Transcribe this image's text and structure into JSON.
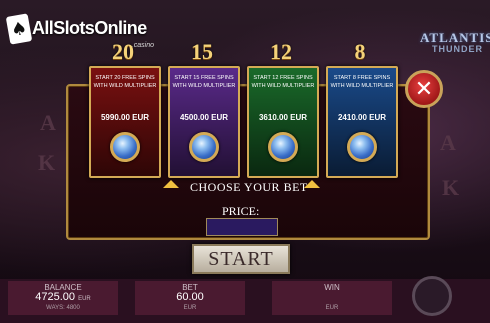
{
  "logo": {
    "name": "AllSlotsOnline",
    "sub": ".casino"
  },
  "game_title": {
    "line1": "ATLANTIS",
    "line2": "THUNDER"
  },
  "cards": [
    {
      "badge": "20",
      "text": "START 20 FREE SPINS WITH WILD MULTIPLIER",
      "price": "5990.00 EUR",
      "color": "#7a1010"
    },
    {
      "badge": "15",
      "text": "START 15 FREE SPINS WITH WILD MULTIPLIER",
      "price": "4500.00 EUR",
      "color": "#5a2a8a"
    },
    {
      "badge": "12",
      "text": "START 12 FREE SPINS WITH WILD MULTIPLIER",
      "price": "3610.00 EUR",
      "color": "#1a6a2a"
    },
    {
      "badge": "8",
      "text": "START 8 FREE SPINS WITH WILD MULTIPLIER",
      "price": "2410.00 EUR",
      "color": "#1a4a8a"
    }
  ],
  "choose_label": "CHOOSE YOUR BET",
  "price_label": "PRICE:",
  "start_label": "START",
  "close_icon": "close-icon",
  "balance": {
    "label": "BALANCE",
    "value": "4725.00",
    "unit": "EUR",
    "sub": "WAYS: 4800"
  },
  "bet": {
    "label": "BET",
    "value": "60.00",
    "unit": "EUR"
  },
  "win": {
    "label": "WIN",
    "unit": "EUR"
  }
}
